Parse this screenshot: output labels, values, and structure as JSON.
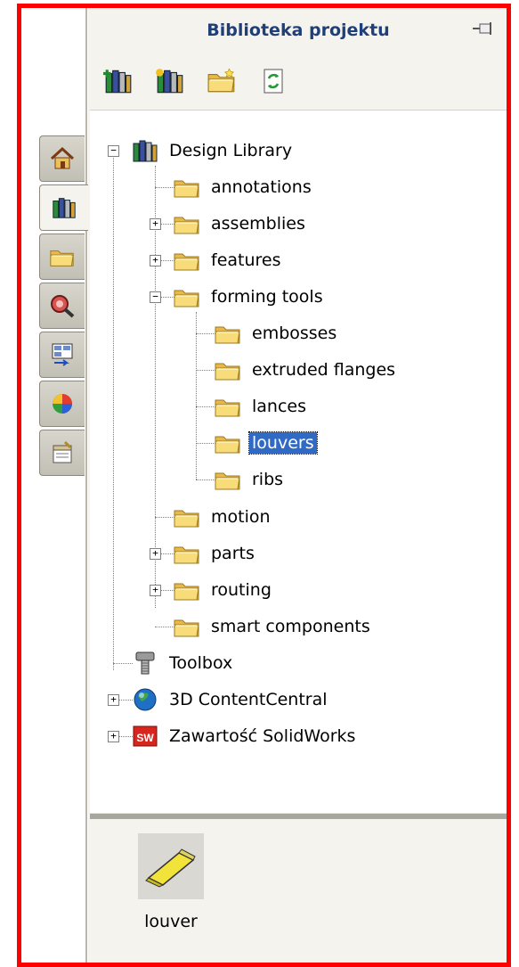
{
  "panel": {
    "title": "Biblioteka projektu"
  },
  "side_tabs": [
    {
      "icon": "home-icon"
    },
    {
      "icon": "design-library-icon",
      "active": true
    },
    {
      "icon": "file-explorer-folder-icon"
    },
    {
      "icon": "search-icon"
    },
    {
      "icon": "view-palette-icon"
    },
    {
      "icon": "appearances-icon"
    },
    {
      "icon": "custom-properties-icon"
    }
  ],
  "toolbar": [
    {
      "icon": "add-to-library-icon"
    },
    {
      "icon": "add-file-location-icon"
    },
    {
      "icon": "create-new-folder-icon"
    },
    {
      "icon": "refresh-icon"
    }
  ],
  "tree": {
    "design_library": "Design Library",
    "annotations": "annotations",
    "assemblies": "assemblies",
    "features": "features",
    "forming_tools": "forming tools",
    "embosses": "embosses",
    "extruded_flanges": "extruded flanges",
    "lances": "lances",
    "louvers": "louvers",
    "ribs": "ribs",
    "motion": "motion",
    "parts": "parts",
    "routing": "routing",
    "smart_components": "smart components",
    "toolbox": "Toolbox",
    "content_central": "3D ContentCentral",
    "solidworks_content": "Zawartość SolidWorks"
  },
  "preview": {
    "item_label": "louver"
  },
  "colors": {
    "frame_border": "#ff0000",
    "title_text": "#1f3f7a",
    "selection": "#316ac5",
    "folder": "#f5d36b"
  }
}
